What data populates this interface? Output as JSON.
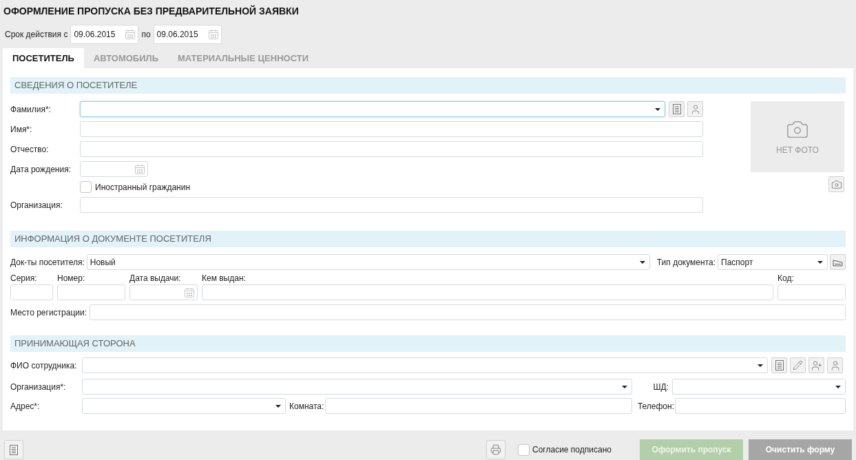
{
  "title": "ОФОРМЛЕНИЕ ПРОПУСКА БЕЗ ПРЕДВАРИТЕЛЬНОЙ ЗАЯВКИ",
  "validity": {
    "label": "Срок действия с",
    "from": "09.06.2015",
    "to_label": "по",
    "to": "09.06.2015"
  },
  "tabs": [
    {
      "label": "ПОСЕТИТЕЛЬ",
      "selected": true
    },
    {
      "label": "АВТОМОБИЛЬ",
      "selected": false
    },
    {
      "label": "МАТЕРИАЛЬНЫЕ ЦЕННОСТИ",
      "selected": false
    }
  ],
  "visitor": {
    "title": "СВЕДЕНИЯ О ПОСЕТИТЕЛЕ",
    "fields": [
      {
        "label": "Фамилия*:",
        "kind": "select",
        "focused": true
      },
      {
        "label": "Имя*:",
        "kind": "text"
      },
      {
        "label": "Отчество:",
        "kind": "text"
      },
      {
        "label": "Дата рождения:",
        "kind": "date"
      },
      {
        "label": "Иностранный гражданин",
        "kind": "checkbox",
        "checked": false
      },
      {
        "label": "Организация:",
        "kind": "text"
      }
    ],
    "photo": {
      "text": "НЕТ ФОТО"
    }
  },
  "document": {
    "title": "ИНФОРМАЦИЯ О ДОКУМЕНТЕ ПОСЕТИТЕЛЯ",
    "docs": {
      "label": "Док-ты посетителя:",
      "value": "Новый"
    },
    "doc_type": {
      "label": "Тип документа:",
      "value": "Паспорт"
    },
    "fields": [
      {
        "label": "Серия:",
        "kind": "text"
      },
      {
        "label": "Номер:",
        "kind": "text"
      },
      {
        "label": "Дата выдачи:",
        "kind": "date"
      },
      {
        "label": "Кем выдан:",
        "kind": "text"
      },
      {
        "label": "Код:",
        "kind": "text"
      }
    ],
    "registration": {
      "label": "Место регистрации:"
    }
  },
  "host": {
    "title": "ПРИНИМАЮЩАЯ СТОРОНА",
    "employee": {
      "label": "ФИО сотрудника:"
    },
    "organization": {
      "label": "Организация*:"
    },
    "shd": {
      "label": "ШД:"
    },
    "address": {
      "label": "Адрес*:"
    },
    "room": {
      "label": "Комната:"
    },
    "phone": {
      "label": "Телефон:"
    }
  },
  "footer": {
    "consent": {
      "label": "Согласие подписано",
      "checked": false
    },
    "submit": {
      "label": "Оформить пропуск",
      "disabled": true
    },
    "clear": {
      "label": "Очистить форму"
    }
  }
}
